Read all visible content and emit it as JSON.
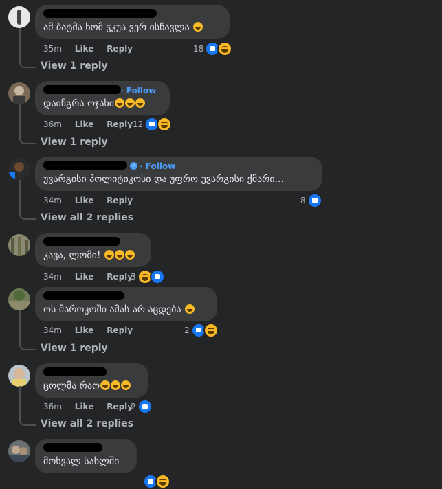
{
  "actions": {
    "like": "Like",
    "reply": "Reply",
    "follow": "Follow"
  },
  "comments": [
    {
      "time": "35m",
      "text": "ამ ბატმა ხომ ჭკუა ვერ ისწავლა",
      "reactions": "18",
      "replies": "View 1 reply"
    },
    {
      "time": "36m",
      "text": "დაინგრა ოჯახი",
      "reactions": "12",
      "replies": "View 1 reply"
    },
    {
      "time": "34m",
      "text": "უვარგისი პოლიტიკოსი და უფრო უვარგისი ქმარი...",
      "reactions": "8",
      "replies": "View all 2 replies"
    },
    {
      "time": "34m",
      "text": "კავა, ლომი!",
      "reactions": "3",
      "replies": ""
    },
    {
      "time": "34m",
      "text": "ოს მაროკოში ამას არ აცდება",
      "reactions": "2",
      "replies": "View 1 reply"
    },
    {
      "time": "36m",
      "text": "ცოლმა რაო",
      "reactions": "2",
      "replies": "View all 2 replies"
    },
    {
      "time": "",
      "text": "მოხვალ სახლში",
      "reactions": "",
      "replies": ""
    }
  ]
}
